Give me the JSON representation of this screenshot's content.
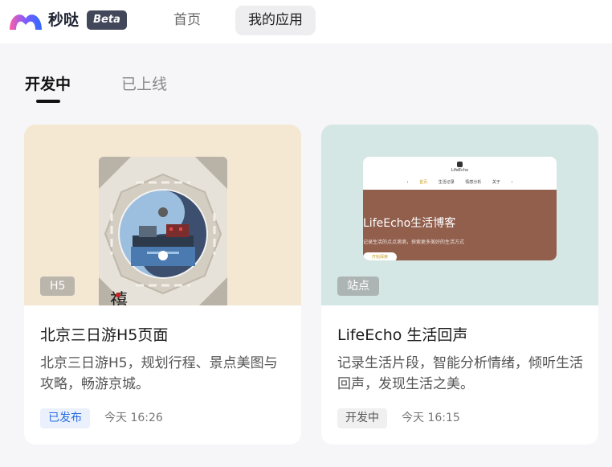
{
  "header": {
    "brand": "秒哒",
    "beta": "Beta",
    "nav": [
      "首页",
      "我的应用"
    ]
  },
  "tabs": [
    "开发中",
    "已上线"
  ],
  "cards": [
    {
      "tag": "H5",
      "title": "北京三日游H5页面",
      "description": "北京三日游H5，规划行程、景点美图与攻略，畅游京城。",
      "status": "已发布",
      "time": "今天 16:26"
    },
    {
      "tag": "站点",
      "title": "LifeEcho 生活回声",
      "description": "记录生活片段，智能分析情绪，倾听生活回声，发现生活之美。",
      "status": "开发中",
      "time": "今天 16:15",
      "preview": {
        "logo": "LifeEcho",
        "menu": [
          "‹",
          "首页",
          "生活记录",
          "情感分析",
          "关于",
          "›"
        ],
        "hero_title": "LifeEcho生活博客",
        "hero_subtitle": "记录生活的点点滴滴，探索更多美好的生活方式",
        "hero_button": "开始探索"
      }
    }
  ],
  "colors": {
    "accent_blue": "#2b6de0",
    "cover_1": "#f4e8d3",
    "cover_2": "#d4e7e4",
    "hero_brown": "#925f4d"
  }
}
